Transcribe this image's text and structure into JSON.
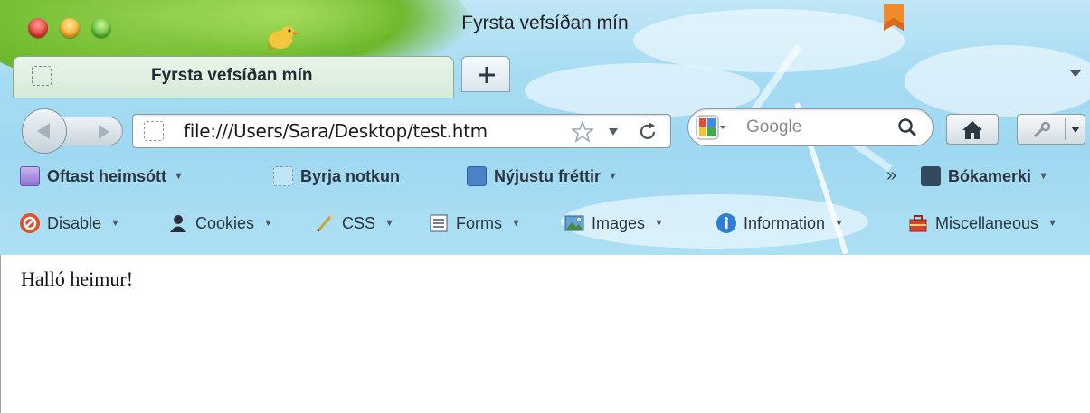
{
  "window": {
    "title": "Fyrsta vefsíðan mín"
  },
  "tabs": [
    {
      "title": "Fyrsta vefsíðan mín",
      "favicon": "blank-page-icon",
      "active": true
    }
  ],
  "navigation": {
    "url": "file:///Users/Sara/Desktop/test.htm",
    "search_engine": "google-icon",
    "search_placeholder": "Google"
  },
  "bookmarks_bar": {
    "items": [
      {
        "label": "Oftast heimsótt",
        "icon": "folder-icon",
        "has_menu": true
      },
      {
        "label": "Byrja notkun",
        "icon": "blank-page-icon",
        "has_menu": false
      },
      {
        "label": "Nýjustu fréttir",
        "icon": "rss-icon",
        "has_menu": true
      }
    ],
    "overflow": "»",
    "bookmarks_menu": "Bókamerki"
  },
  "web_developer_toolbar": {
    "items": [
      {
        "label": "Disable",
        "icon": "disable-icon"
      },
      {
        "label": "Cookies",
        "icon": "user-icon"
      },
      {
        "label": "CSS",
        "icon": "pencil-icon"
      },
      {
        "label": "Forms",
        "icon": "form-icon"
      },
      {
        "label": "Images",
        "icon": "image-icon"
      },
      {
        "label": "Information",
        "icon": "info-icon"
      },
      {
        "label": "Miscellaneous",
        "icon": "toolbox-icon"
      }
    ]
  },
  "page": {
    "text": "Halló heimur!"
  },
  "colors": {
    "sky": "#a6dcf3",
    "tree_green": "#6bb82c",
    "close": "#e0322b",
    "minimize": "#f2a81d",
    "maximize": "#58b82e"
  }
}
